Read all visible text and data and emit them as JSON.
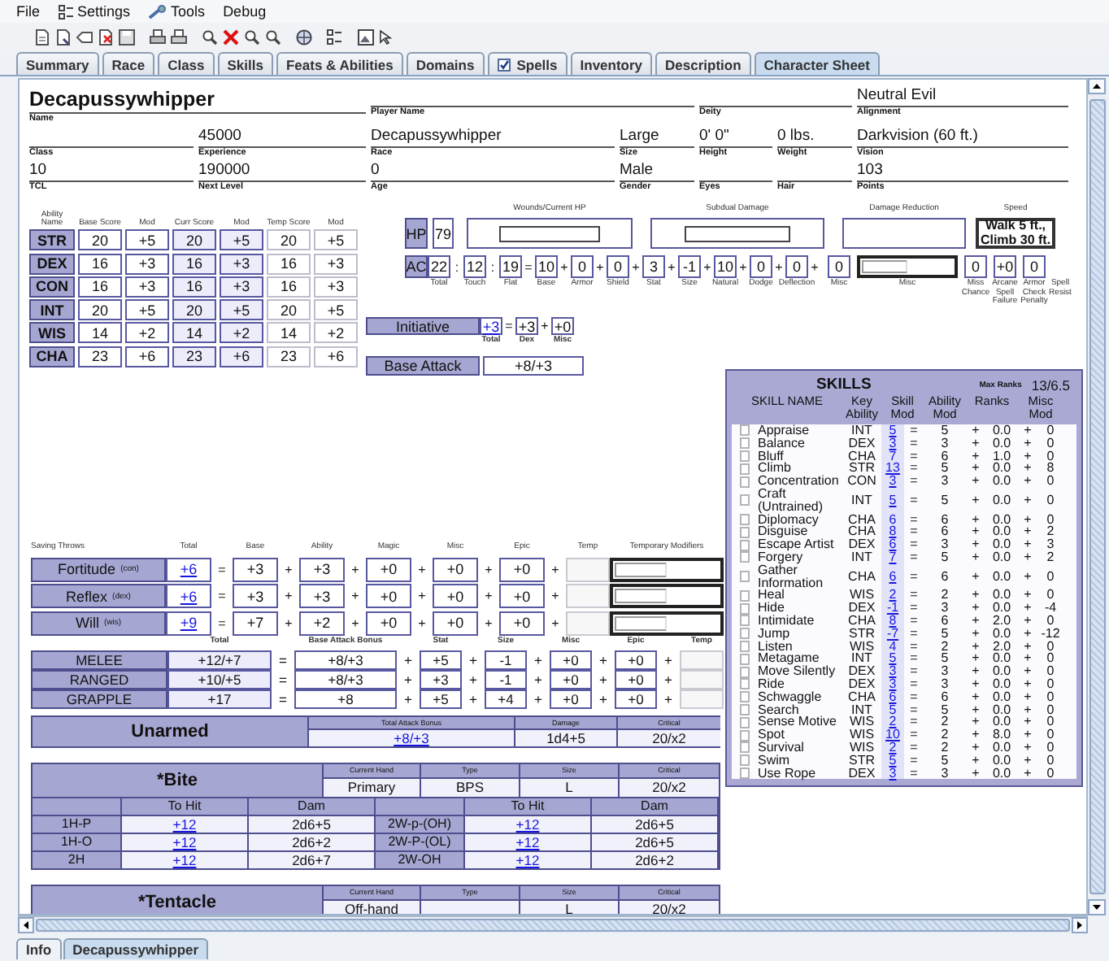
{
  "menu": [
    {
      "label": "File",
      "kind": "plain"
    },
    {
      "label": "Settings",
      "kind": "settings"
    },
    {
      "label": "Tools",
      "kind": "tools"
    },
    {
      "label": "Debug",
      "kind": "plain"
    }
  ],
  "tabs": [
    {
      "label": "Summary",
      "selected": false,
      "kind": "plain"
    },
    {
      "label": "Race",
      "selected": false,
      "kind": "plain"
    },
    {
      "label": "Class",
      "selected": false,
      "kind": "plain"
    },
    {
      "label": "Skills",
      "selected": false,
      "kind": "plain"
    },
    {
      "label": "Feats & Abilities",
      "selected": false,
      "kind": "plain"
    },
    {
      "label": "Domains",
      "selected": false,
      "kind": "plain"
    },
    {
      "label": "Spells",
      "selected": false,
      "kind": "checkbox",
      "checked": true
    },
    {
      "label": "Inventory",
      "selected": false,
      "kind": "plain"
    },
    {
      "label": "Description",
      "selected": false,
      "kind": "plain"
    },
    {
      "label": "Character Sheet",
      "selected": true,
      "kind": "plain"
    }
  ],
  "character": {
    "top_line": [
      {
        "value": "Decapussywhipper",
        "label": "Name"
      },
      {
        "label": "Player Name"
      },
      {
        "label": "Deity"
      },
      {
        "value": "Neutral Evil",
        "label": "Alignment"
      }
    ],
    "second_line": [
      {
        "label": "Class"
      },
      {
        "value": "45000",
        "label": "Experience"
      },
      {
        "value": "Decapussywhipper",
        "label": "Race"
      },
      {
        "value": "Large",
        "label": "Size"
      },
      {
        "value": "0' 0\"",
        "label": "Height"
      },
      {
        "value": "0 lbs.",
        "label": "Weight"
      },
      {
        "value": "Darkvision (60 ft.)",
        "label": "Vision"
      }
    ],
    "third_line": [
      {
        "value": "10",
        "label": "TCL"
      },
      {
        "value": "190000",
        "label": "Next Level"
      },
      {
        "value": "0",
        "label": "Age"
      },
      {
        "value": "Male",
        "label": "Gender"
      },
      {
        "label": "Eyes"
      },
      {
        "label": "Hair"
      },
      {
        "value": "103",
        "label": "Points"
      }
    ]
  },
  "abilities": {
    "columns": [
      "Ability Name",
      "Base Score",
      "Mod",
      "Curr Score",
      "Mod",
      "Temp Score",
      "Mod"
    ],
    "rows": [
      [
        "STR",
        "20",
        "+5",
        "20",
        "+5",
        "20",
        "+5"
      ],
      [
        "DEX",
        "16",
        "+3",
        "16",
        "+3",
        "16",
        "+3"
      ],
      [
        "CON",
        "16",
        "+3",
        "16",
        "+3",
        "16",
        "+3"
      ],
      [
        "INT",
        "20",
        "+5",
        "20",
        "+5",
        "20",
        "+5"
      ],
      [
        "WIS",
        "14",
        "+2",
        "14",
        "+2",
        "14",
        "+2"
      ],
      [
        "CHA",
        "23",
        "+6",
        "23",
        "+6",
        "23",
        "+6"
      ]
    ]
  },
  "hp": {
    "label": "HP",
    "value": "79",
    "panels": [
      {
        "title": "Wounds/Current HP",
        "kind": "input"
      },
      {
        "title": "Subdual Damage",
        "kind": "input"
      },
      {
        "title": "Damage Reduction",
        "kind": "empty"
      },
      {
        "title": "Speed",
        "kind": "text",
        "value": "Walk 5 ft., Climb 30 ft."
      }
    ]
  },
  "ac": {
    "tokens": [
      {
        "kind": "head",
        "text": "AC"
      },
      {
        "kind": "box",
        "text": "22",
        "caption": "Total"
      },
      {
        "kind": "op",
        "text": ":"
      },
      {
        "kind": "box",
        "text": "12",
        "caption": "Touch"
      },
      {
        "kind": "op",
        "text": ":"
      },
      {
        "kind": "box",
        "text": "19",
        "caption": "Flat"
      },
      {
        "kind": "op",
        "text": "="
      },
      {
        "kind": "box",
        "text": "10",
        "caption": "Base"
      },
      {
        "kind": "op",
        "text": "+"
      },
      {
        "kind": "box",
        "text": "0",
        "caption": "Armor"
      },
      {
        "kind": "op",
        "text": "+"
      },
      {
        "kind": "box",
        "text": "0",
        "caption": "Shield"
      },
      {
        "kind": "op",
        "text": "+"
      },
      {
        "kind": "box",
        "text": "3",
        "caption": "Stat"
      },
      {
        "kind": "op",
        "text": "+"
      },
      {
        "kind": "box",
        "text": "-1",
        "caption": "Size"
      },
      {
        "kind": "op",
        "text": "+"
      },
      {
        "kind": "box",
        "text": "10",
        "caption": "Natural"
      },
      {
        "kind": "op",
        "text": "+"
      },
      {
        "kind": "box",
        "text": "0",
        "caption": "Dodge"
      },
      {
        "kind": "op",
        "text": "+"
      },
      {
        "kind": "box",
        "text": "0",
        "caption": "Deflection"
      },
      {
        "kind": "op",
        "text": "+"
      },
      {
        "kind": "box",
        "text": "0",
        "caption": "Misc"
      },
      {
        "kind": "input",
        "caption": "Misc"
      },
      {
        "kind": "box",
        "text": "0",
        "caption": "Miss Chance"
      },
      {
        "kind": "box",
        "text": "+0",
        "caption": "Arcane Spell Failure"
      },
      {
        "kind": "box",
        "text": "0",
        "caption": "Armor Check Penalty"
      },
      {
        "kind": "gap",
        "caption": "Spell Resist"
      }
    ]
  },
  "initiative": {
    "tokens": [
      {
        "kind": "head",
        "text": "Initiative"
      },
      {
        "kind": "link",
        "text": "+3",
        "caption": "Total"
      },
      {
        "kind": "op",
        "text": "="
      },
      {
        "kind": "box",
        "text": "+3",
        "caption": "Dex"
      },
      {
        "kind": "op",
        "text": "+"
      },
      {
        "kind": "box",
        "text": "+0",
        "caption": "Misc"
      }
    ]
  },
  "base_attack": {
    "tokens": [
      {
        "kind": "head",
        "text": "Base Attack"
      },
      {
        "kind": "wide",
        "text": "+8/+3"
      }
    ]
  },
  "saves": {
    "header": [
      {
        "kind": "caption",
        "text": "Saving Throws"
      },
      {
        "kind": "caption",
        "text": "Total"
      },
      {
        "kind": "gap"
      },
      {
        "kind": "caption",
        "text": "Base"
      },
      {
        "kind": "gap"
      },
      {
        "kind": "caption",
        "text": "Ability"
      },
      {
        "kind": "gap"
      },
      {
        "kind": "caption",
        "text": "Magic"
      },
      {
        "kind": "gap"
      },
      {
        "kind": "caption",
        "text": "Misc"
      },
      {
        "kind": "gap"
      },
      {
        "kind": "caption",
        "text": "Epic"
      },
      {
        "kind": "gap"
      },
      {
        "kind": "caption",
        "text": "Temp"
      },
      {
        "kind": "caption",
        "text": "Temporary Modifiers"
      }
    ],
    "rows": [
      [
        {
          "kind": "head",
          "text": "Fortitude",
          "sub": "(con)"
        },
        {
          "kind": "link",
          "text": "+6"
        },
        {
          "kind": "op",
          "text": "="
        },
        {
          "kind": "box",
          "text": "+3"
        },
        {
          "kind": "op",
          "text": "+"
        },
        {
          "kind": "box",
          "text": "+3"
        },
        {
          "kind": "op",
          "text": "+"
        },
        {
          "kind": "box",
          "text": "+0"
        },
        {
          "kind": "op",
          "text": "+"
        },
        {
          "kind": "box",
          "text": "+0"
        },
        {
          "kind": "op",
          "text": "+"
        },
        {
          "kind": "box",
          "text": "+0"
        },
        {
          "kind": "op",
          "text": "+"
        },
        {
          "kind": "empty"
        },
        {
          "kind": "input"
        }
      ],
      [
        {
          "kind": "head",
          "text": "Reflex",
          "sub": "(dex)"
        },
        {
          "kind": "link",
          "text": "+6"
        },
        {
          "kind": "op",
          "text": "="
        },
        {
          "kind": "box",
          "text": "+3"
        },
        {
          "kind": "op",
          "text": "+"
        },
        {
          "kind": "box",
          "text": "+3"
        },
        {
          "kind": "op",
          "text": "+"
        },
        {
          "kind": "box",
          "text": "+0"
        },
        {
          "kind": "op",
          "text": "+"
        },
        {
          "kind": "box",
          "text": "+0"
        },
        {
          "kind": "op",
          "text": "+"
        },
        {
          "kind": "box",
          "text": "+0"
        },
        {
          "kind": "op",
          "text": "+"
        },
        {
          "kind": "empty"
        },
        {
          "kind": "input"
        }
      ],
      [
        {
          "kind": "head",
          "text": "Will",
          "sub": "(wis)"
        },
        {
          "kind": "link",
          "text": "+9"
        },
        {
          "kind": "op",
          "text": "="
        },
        {
          "kind": "box",
          "text": "+7"
        },
        {
          "kind": "op",
          "text": "+"
        },
        {
          "kind": "box",
          "text": "+2"
        },
        {
          "kind": "op",
          "text": "+"
        },
        {
          "kind": "box",
          "text": "+0"
        },
        {
          "kind": "op",
          "text": "+"
        },
        {
          "kind": "box",
          "text": "+0"
        },
        {
          "kind": "op",
          "text": "+"
        },
        {
          "kind": "box",
          "text": "+0"
        },
        {
          "kind": "op",
          "text": "+"
        },
        {
          "kind": "empty"
        },
        {
          "kind": "input"
        }
      ]
    ]
  },
  "attacks": {
    "header": [
      {
        "kind": "gap"
      },
      {
        "kind": "caption",
        "text": "Total"
      },
      {
        "kind": "gap"
      },
      {
        "kind": "caption",
        "text": "Base Attack Bonus"
      },
      {
        "kind": "gap"
      },
      {
        "kind": "caption",
        "text": "Stat"
      },
      {
        "kind": "gap"
      },
      {
        "kind": "caption",
        "text": "Size"
      },
      {
        "kind": "gap"
      },
      {
        "kind": "caption",
        "text": "Misc"
      },
      {
        "kind": "gap"
      },
      {
        "kind": "caption",
        "text": "Epic"
      },
      {
        "kind": "gap"
      },
      {
        "kind": "caption",
        "text": "Temp"
      }
    ],
    "rows": [
      [
        {
          "kind": "head",
          "text": "MELEE"
        },
        {
          "kind": "shade",
          "text": "+12/+7"
        },
        {
          "kind": "op",
          "text": "="
        },
        {
          "kind": "box",
          "text": "+8/+3"
        },
        {
          "kind": "op",
          "text": "+"
        },
        {
          "kind": "box",
          "text": "+5"
        },
        {
          "kind": "op",
          "text": "+"
        },
        {
          "kind": "box",
          "text": "-1"
        },
        {
          "kind": "op",
          "text": "+"
        },
        {
          "kind": "box",
          "text": "+0"
        },
        {
          "kind": "op",
          "text": "+"
        },
        {
          "kind": "box",
          "text": "+0"
        },
        {
          "kind": "op",
          "text": "+"
        },
        {
          "kind": "empty"
        }
      ],
      [
        {
          "kind": "head",
          "text": "RANGED"
        },
        {
          "kind": "shade",
          "text": "+10/+5"
        },
        {
          "kind": "op",
          "text": "="
        },
        {
          "kind": "box",
          "text": "+8/+3"
        },
        {
          "kind": "op",
          "text": "+"
        },
        {
          "kind": "box",
          "text": "+3"
        },
        {
          "kind": "op",
          "text": "+"
        },
        {
          "kind": "box",
          "text": "-1"
        },
        {
          "kind": "op",
          "text": "+"
        },
        {
          "kind": "box",
          "text": "+0"
        },
        {
          "kind": "op",
          "text": "+"
        },
        {
          "kind": "box",
          "text": "+0"
        },
        {
          "kind": "op",
          "text": "+"
        },
        {
          "kind": "empty"
        }
      ],
      [
        {
          "kind": "head",
          "text": "GRAPPLE"
        },
        {
          "kind": "shade",
          "text": "+17"
        },
        {
          "kind": "op",
          "text": "="
        },
        {
          "kind": "box",
          "text": "+8"
        },
        {
          "kind": "op",
          "text": "+"
        },
        {
          "kind": "box",
          "text": "+5"
        },
        {
          "kind": "op",
          "text": "+"
        },
        {
          "kind": "box",
          "text": "+4"
        },
        {
          "kind": "op",
          "text": "+"
        },
        {
          "kind": "box",
          "text": "+0"
        },
        {
          "kind": "op",
          "text": "+"
        },
        {
          "kind": "box",
          "text": "+0"
        },
        {
          "kind": "op",
          "text": "+"
        },
        {
          "kind": "empty"
        }
      ]
    ]
  },
  "unarmed": {
    "name": "Unarmed",
    "fields": [
      {
        "label": "Total Attack Bonus",
        "value": "+8/+3",
        "kind": "link"
      },
      {
        "label": "Damage",
        "value": "1d4+5",
        "kind": "text"
      },
      {
        "label": "Critical",
        "value": "20/x2",
        "kind": "text"
      }
    ]
  },
  "weapons": [
    {
      "name": "*Bite",
      "fields": [
        {
          "label": "Current Hand",
          "value": "Primary",
          "kind": "text"
        },
        {
          "label": "Type",
          "value": "BPS",
          "kind": "text"
        },
        {
          "label": "Size",
          "value": "L",
          "kind": "text"
        },
        {
          "label": "Critical",
          "value": "20/x2",
          "kind": "text"
        }
      ],
      "attack_modes": {
        "headings": [
          "To Hit",
          "Dam",
          "To Hit",
          "Dam"
        ],
        "modes": [
          {
            "left": {
              "grip": "1H-P",
              "to_hit": "+12",
              "damage": "2d6+5"
            },
            "right": {
              "grip": "2W-p-(OH)",
              "to_hit": "+12",
              "damage": "2d6+5"
            }
          },
          {
            "left": {
              "grip": "1H-O",
              "to_hit": "+12",
              "damage": "2d6+2"
            },
            "right": {
              "grip": "2W-P-(OL)",
              "to_hit": "+12",
              "damage": "2d6+5"
            }
          },
          {
            "left": {
              "grip": "2H",
              "to_hit": "+12",
              "damage": "2d6+7"
            },
            "right": {
              "grip": "2W-OH",
              "to_hit": "+12",
              "damage": "2d6+2"
            }
          }
        ]
      }
    },
    {
      "name": "*Tentacle",
      "fields": [
        {
          "label": "Current Hand",
          "value": "Off-hand",
          "kind": "text"
        },
        {
          "label": "Type",
          "kind": "text"
        },
        {
          "label": "Size",
          "value": "L",
          "kind": "text"
        },
        {
          "label": "Critical",
          "value": "20/x2",
          "kind": "text"
        }
      ]
    }
  ],
  "skills": {
    "title": "SKILLS",
    "max_ranks_label": "Max Ranks",
    "max_ranks": "13/6.5",
    "headings": [
      "SKILL NAME",
      "Key Ability",
      "Skill Mod",
      "Ability Mod",
      "Ranks",
      "Misc Mod"
    ],
    "list": [
      {
        "checked": false,
        "name": "Appraise",
        "key_ability": "INT",
        "skill_mod": "5",
        "equals": "=",
        "ability_mod": "5",
        "plus_ranks": "+",
        "ranks": "0.0",
        "plus_misc": "+",
        "misc_mod": "0"
      },
      {
        "checked": false,
        "name": "Balance",
        "key_ability": "DEX",
        "skill_mod": "3",
        "equals": "=",
        "ability_mod": "3",
        "plus_ranks": "+",
        "ranks": "0.0",
        "plus_misc": "+",
        "misc_mod": "0"
      },
      {
        "checked": false,
        "name": "Bluff",
        "key_ability": "CHA",
        "skill_mod": "7",
        "equals": "=",
        "ability_mod": "6",
        "plus_ranks": "+",
        "ranks": "1.0",
        "plus_misc": "+",
        "misc_mod": "0"
      },
      {
        "checked": false,
        "name": "Climb",
        "key_ability": "STR",
        "skill_mod": "13",
        "equals": "=",
        "ability_mod": "5",
        "plus_ranks": "+",
        "ranks": "0.0",
        "plus_misc": "+",
        "misc_mod": "8"
      },
      {
        "checked": false,
        "name": "Concentration",
        "key_ability": "CON",
        "skill_mod": "3",
        "equals": "=",
        "ability_mod": "3",
        "plus_ranks": "+",
        "ranks": "0.0",
        "plus_misc": "+",
        "misc_mod": "0"
      },
      {
        "checked": false,
        "name": "Craft (Untrained)",
        "key_ability": "INT",
        "skill_mod": "5",
        "equals": "=",
        "ability_mod": "5",
        "plus_ranks": "+",
        "ranks": "0.0",
        "plus_misc": "+",
        "misc_mod": "0"
      },
      {
        "checked": false,
        "name": "Diplomacy",
        "key_ability": "CHA",
        "skill_mod": "6",
        "equals": "=",
        "ability_mod": "6",
        "plus_ranks": "+",
        "ranks": "0.0",
        "plus_misc": "+",
        "misc_mod": "0"
      },
      {
        "checked": false,
        "name": "Disguise",
        "key_ability": "CHA",
        "skill_mod": "8",
        "equals": "=",
        "ability_mod": "6",
        "plus_ranks": "+",
        "ranks": "0.0",
        "plus_misc": "+",
        "misc_mod": "2"
      },
      {
        "checked": false,
        "name": "Escape Artist",
        "key_ability": "DEX",
        "skill_mod": "6",
        "equals": "=",
        "ability_mod": "3",
        "plus_ranks": "+",
        "ranks": "0.0",
        "plus_misc": "+",
        "misc_mod": "3"
      },
      {
        "checked": false,
        "name": "Forgery",
        "key_ability": "INT",
        "skill_mod": "7",
        "equals": "=",
        "ability_mod": "5",
        "plus_ranks": "+",
        "ranks": "0.0",
        "plus_misc": "+",
        "misc_mod": "2"
      },
      {
        "checked": false,
        "name": "Gather Information",
        "key_ability": "CHA",
        "skill_mod": "6",
        "equals": "=",
        "ability_mod": "6",
        "plus_ranks": "+",
        "ranks": "0.0",
        "plus_misc": "+",
        "misc_mod": "0"
      },
      {
        "checked": false,
        "name": "Heal",
        "key_ability": "WIS",
        "skill_mod": "2",
        "equals": "=",
        "ability_mod": "2",
        "plus_ranks": "+",
        "ranks": "0.0",
        "plus_misc": "+",
        "misc_mod": "0"
      },
      {
        "checked": false,
        "name": "Hide",
        "key_ability": "DEX",
        "skill_mod": "-1",
        "equals": "=",
        "ability_mod": "3",
        "plus_ranks": "+",
        "ranks": "0.0",
        "plus_misc": "+",
        "misc_mod": "-4"
      },
      {
        "checked": false,
        "name": "Intimidate",
        "key_ability": "CHA",
        "skill_mod": "8",
        "equals": "=",
        "ability_mod": "6",
        "plus_ranks": "+",
        "ranks": "2.0",
        "plus_misc": "+",
        "misc_mod": "0"
      },
      {
        "checked": false,
        "name": "Jump",
        "key_ability": "STR",
        "skill_mod": "-7",
        "equals": "=",
        "ability_mod": "5",
        "plus_ranks": "+",
        "ranks": "0.0",
        "plus_misc": "+",
        "misc_mod": "-12"
      },
      {
        "checked": false,
        "name": "Listen",
        "key_ability": "WIS",
        "skill_mod": "4",
        "equals": "=",
        "ability_mod": "2",
        "plus_ranks": "+",
        "ranks": "2.0",
        "plus_misc": "+",
        "misc_mod": "0"
      },
      {
        "checked": false,
        "name": "Metagame",
        "key_ability": "INT",
        "skill_mod": "5",
        "equals": "=",
        "ability_mod": "5",
        "plus_ranks": "+",
        "ranks": "0.0",
        "plus_misc": "+",
        "misc_mod": "0"
      },
      {
        "checked": false,
        "name": "Move Silently",
        "key_ability": "DEX",
        "skill_mod": "3",
        "equals": "=",
        "ability_mod": "3",
        "plus_ranks": "+",
        "ranks": "0.0",
        "plus_misc": "+",
        "misc_mod": "0"
      },
      {
        "checked": false,
        "name": "Ride",
        "key_ability": "DEX",
        "skill_mod": "3",
        "equals": "=",
        "ability_mod": "3",
        "plus_ranks": "+",
        "ranks": "0.0",
        "plus_misc": "+",
        "misc_mod": "0"
      },
      {
        "checked": false,
        "name": "Schwaggle",
        "key_ability": "CHA",
        "skill_mod": "6",
        "equals": "=",
        "ability_mod": "6",
        "plus_ranks": "+",
        "ranks": "0.0",
        "plus_misc": "+",
        "misc_mod": "0"
      },
      {
        "checked": false,
        "name": "Search",
        "key_ability": "INT",
        "skill_mod": "5",
        "equals": "=",
        "ability_mod": "5",
        "plus_ranks": "+",
        "ranks": "0.0",
        "plus_misc": "+",
        "misc_mod": "0"
      },
      {
        "checked": false,
        "name": "Sense Motive",
        "key_ability": "WIS",
        "skill_mod": "2",
        "equals": "=",
        "ability_mod": "2",
        "plus_ranks": "+",
        "ranks": "0.0",
        "plus_misc": "+",
        "misc_mod": "0"
      },
      {
        "checked": false,
        "name": "Spot",
        "key_ability": "WIS",
        "skill_mod": "10",
        "equals": "=",
        "ability_mod": "2",
        "plus_ranks": "+",
        "ranks": "8.0",
        "plus_misc": "+",
        "misc_mod": "0"
      },
      {
        "checked": false,
        "name": "Survival",
        "key_ability": "WIS",
        "skill_mod": "2",
        "equals": "=",
        "ability_mod": "2",
        "plus_ranks": "+",
        "ranks": "0.0",
        "plus_misc": "+",
        "misc_mod": "0"
      },
      {
        "checked": false,
        "name": "Swim",
        "key_ability": "STR",
        "skill_mod": "5",
        "equals": "=",
        "ability_mod": "5",
        "plus_ranks": "+",
        "ranks": "0.0",
        "plus_misc": "+",
        "misc_mod": "0"
      },
      {
        "checked": false,
        "name": "Use Rope",
        "key_ability": "DEX",
        "skill_mod": "3",
        "equals": "=",
        "ability_mod": "3",
        "plus_ranks": "+",
        "ranks": "0.0",
        "plus_misc": "+",
        "misc_mod": "0"
      }
    ]
  },
  "bottom_tabs": [
    {
      "label": "Info",
      "selected": false
    },
    {
      "label": "Decapussywhipper",
      "selected": true
    }
  ]
}
